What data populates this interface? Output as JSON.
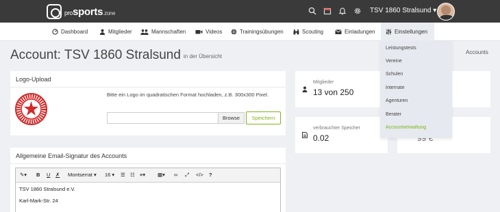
{
  "brand": {
    "pre": "pro",
    "main": "sports",
    "post": ".zone"
  },
  "top_icons": [
    "search-icon",
    "calendar-icon",
    "bell-icon",
    "gear-icon"
  ],
  "team_selector": {
    "label": "TSV 1860 Stralsund",
    "caret": "▾"
  },
  "nav": [
    {
      "label": "Dashboard",
      "icon": "dashboard-icon"
    },
    {
      "label": "Mitglieder",
      "icon": "user-icon"
    },
    {
      "label": "Mannschaften",
      "icon": "users-icon"
    },
    {
      "label": "Videos",
      "icon": "video-icon"
    },
    {
      "label": "Trainingsübungen",
      "icon": "globe-icon"
    },
    {
      "label": "Scouting",
      "icon": "binoculars-icon"
    },
    {
      "label": "Einladungen",
      "icon": "envelope-icon"
    },
    {
      "label": "Einstellungen",
      "icon": "sliders-icon"
    }
  ],
  "dropdown": {
    "items": [
      "Leistungstests",
      "Vereine",
      "Schulen",
      "Internate",
      "Agenturen",
      "Berater",
      "Accountverwaltung"
    ],
    "active_color": "#7cb518"
  },
  "page": {
    "title": "Account: TSV 1860 Stralsund",
    "subtitle": "in der Übersicht",
    "breadcrumb": "Accounts"
  },
  "logo_upload": {
    "heading": "Logo-Upload",
    "hint": "Bitte ein Logo im quadratischen Format hochladen, z.B. 300x300 Pixel.",
    "browse_label": "Browse",
    "save_label": "Speichern",
    "seal_text": "TSV 1860 STRALSUND"
  },
  "signature": {
    "heading": "Allgemeine Email-Signatur des Accounts",
    "font_name": "Montserrat",
    "font_size": "16",
    "lines": [
      "TSV 1860 Stralsund e.V.",
      "Karl-Mark-Str. 24"
    ]
  },
  "stats": {
    "members": {
      "label": "Mitglieder",
      "value": "13 von 250"
    },
    "storage": {
      "label": "verbrauchter Speicher",
      "value": "0.02"
    },
    "partial_value": "99 €"
  },
  "colors": {
    "accent": "#7cb518",
    "topbar": "#3a3a3a",
    "seal_red": "#d42a2a"
  }
}
